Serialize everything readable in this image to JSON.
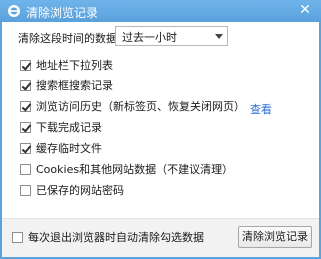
{
  "window": {
    "title": "清除浏览记录",
    "close_symbol": "✕",
    "icon": "ie-browser-icon"
  },
  "time_range": {
    "label": "清除这段时间的数据：",
    "selected": "过去一小时",
    "dropdown_icon": "chevron-down-icon"
  },
  "options": [
    {
      "label": "地址栏下拉列表",
      "checked": true
    },
    {
      "label": "搜索框搜索记录",
      "checked": true
    },
    {
      "label": "浏览访问历史（新标签页、恢复关闭网页）",
      "checked": true
    },
    {
      "label": "下载完成记录",
      "checked": true
    },
    {
      "label": "缓存临时文件",
      "checked": true
    },
    {
      "label": "Cookies和其他网站数据（不建议清理）",
      "checked": false
    },
    {
      "label": "已保存的网站密码",
      "checked": false
    }
  ],
  "view_link": "查看",
  "footer": {
    "auto_clear_label": "每次退出浏览器时自动清除勾选数据",
    "auto_clear_checked": false,
    "clear_button": "清除浏览记录"
  },
  "colors": {
    "titlebar": "#5ba3dd",
    "link": "#2a6fd6",
    "client_bg": "#ffffff",
    "footer_bg": "#f2f2f2"
  }
}
